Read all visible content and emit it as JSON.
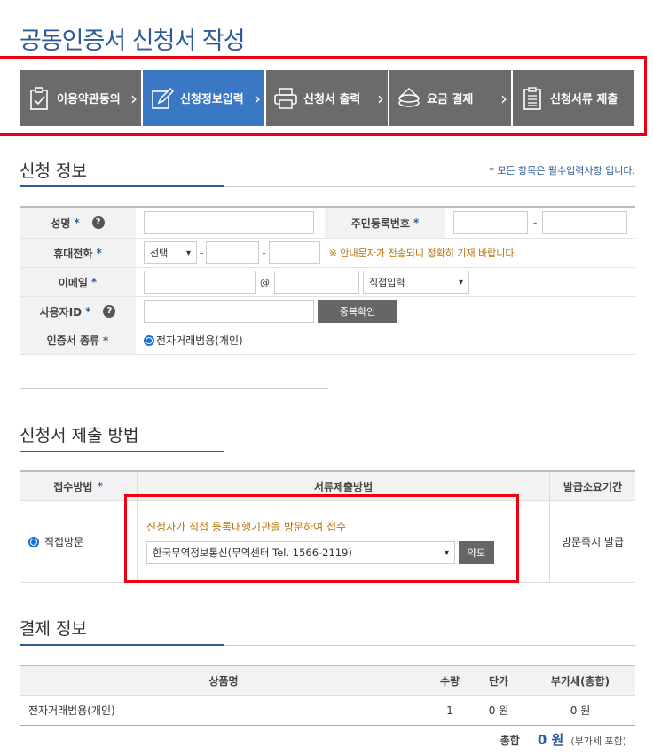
{
  "page_title": "공동인증서 신청서 작성",
  "steps": [
    {
      "label": "이용약관동의",
      "icon": "clipboard-check-icon"
    },
    {
      "label": "신청정보입력",
      "icon": "pencil-form-icon"
    },
    {
      "label": "신청서 출력",
      "icon": "printer-icon"
    },
    {
      "label": "요금 결제",
      "icon": "coins-icon"
    },
    {
      "label": "신청서류 제출",
      "icon": "document-list-icon"
    }
  ],
  "applicant": {
    "title": "신청 정보",
    "required_note": "* 모든 항목은 필수입력사항 입니다.",
    "name_label": "성명",
    "rrn_label": "주민등록번호",
    "phone_label": "휴대전화",
    "phone_select": "선택",
    "phone_notice": "※ 안내문자가 전송되니 정확히 기재 바랍니다.",
    "email_label": "이메일",
    "email_at": "@",
    "email_domain_select": "직접입력",
    "userid_label": "사용자ID",
    "dup_check_button": "중복확인",
    "cert_type_label": "인증서 종류",
    "cert_type_option": "전자거래범용(개인)",
    "star": "*",
    "help": "?"
  },
  "submission": {
    "title": "신청서 제출 방법",
    "col_receipt": "접수방법",
    "col_method": "서류제출방법",
    "col_period": "발급소요기간",
    "receipt_option": "직접방문",
    "method_text": "신청자가 직접 등록대행기관을 방문하여 접수",
    "agency_select": "한국무역정보통신(무역센터 Tel. 1566-2119)",
    "map_button": "약도",
    "period_text": "방문즉시 발급"
  },
  "payment": {
    "title": "결제 정보",
    "col_product": "상품명",
    "col_qty": "수량",
    "col_price": "단가",
    "col_vat": "부가세(총합)",
    "rows": [
      {
        "product": "전자거래범용(개인)",
        "qty": "1",
        "price": "0 원",
        "vat": "0 원"
      }
    ],
    "total_label": "총합",
    "total_value": "0 원",
    "total_note": "(부가세 포함)"
  }
}
